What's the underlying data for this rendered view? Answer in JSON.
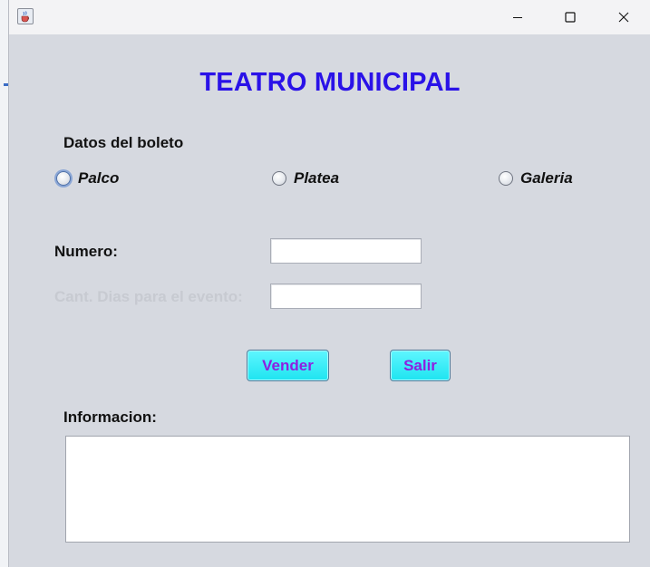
{
  "window": {
    "title": "",
    "icon": "java-cup-icon",
    "controls": {
      "minimize": "minimize-icon",
      "maximize": "maximize-icon",
      "close": "close-icon"
    }
  },
  "header": {
    "title": "TEATRO MUNICIPAL",
    "title_color": "#2a12e8"
  },
  "ticket": {
    "section_label": "Datos del boleto",
    "options": [
      {
        "label": "Palco",
        "selected": false,
        "focused": true
      },
      {
        "label": "Platea",
        "selected": false
      },
      {
        "label": "Galeria",
        "selected": false
      }
    ]
  },
  "form": {
    "numero_label": "Numero:",
    "numero_value": "",
    "dias_label": "Cant. Dias para el evento:",
    "dias_value": "",
    "dias_enabled": false
  },
  "actions": {
    "vender_label": "Vender",
    "salir_label": "Salir",
    "button_bg": "#1ee4f0",
    "button_text": "#8e1fe0"
  },
  "info": {
    "label": "Informacion:",
    "value": ""
  }
}
